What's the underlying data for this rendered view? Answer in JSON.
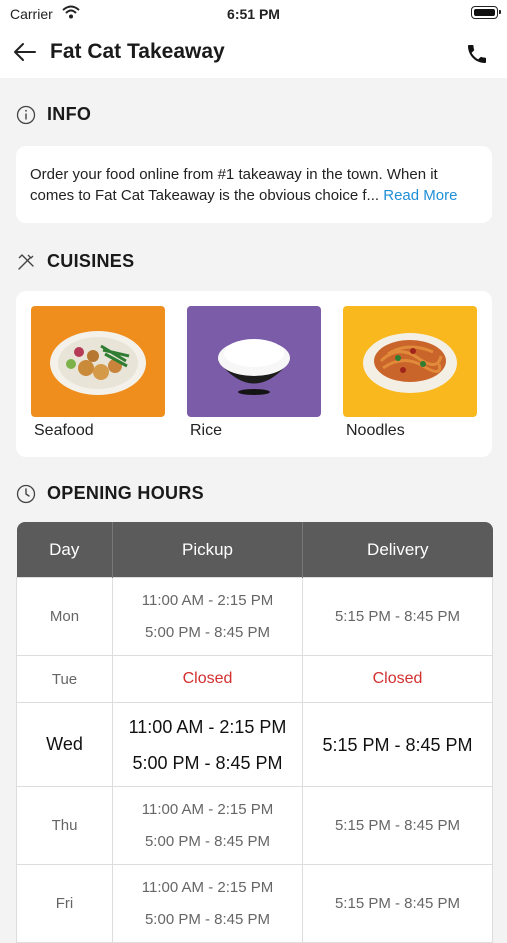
{
  "status_bar": {
    "carrier": "Carrier",
    "time": "6:51 PM"
  },
  "header": {
    "title": "Fat Cat Takeaway",
    "back_icon": "arrow-left-icon",
    "phone_icon": "phone-icon"
  },
  "info": {
    "title": "INFO",
    "text": "Order your food online from #1 takeaway in the town. When it comes to Fat Cat Takeaway is the obvious choice f...",
    "read_more": "Read More"
  },
  "cuisines": {
    "title": "CUISINES",
    "items": [
      {
        "label": "Seafood",
        "bg": "#ef8d1d"
      },
      {
        "label": "Rice",
        "bg": "#7b5ca8"
      },
      {
        "label": "Noodles",
        "bg": "#f8b81e"
      }
    ]
  },
  "opening_hours": {
    "title": "OPENING HOURS",
    "columns": [
      "Day",
      "Pickup",
      "Delivery"
    ],
    "rows": [
      {
        "day": "Mon",
        "pickup": [
          "11:00 AM - 2:15 PM",
          "5:00 PM - 8:45 PM"
        ],
        "delivery": [
          "5:15 PM - 8:45 PM"
        ]
      },
      {
        "day": "Tue",
        "pickup": [
          "Closed"
        ],
        "delivery": [
          "Closed"
        ]
      },
      {
        "day": "Wed",
        "pickup": [
          "11:00 AM - 2:15 PM",
          "5:00 PM - 8:45 PM"
        ],
        "delivery": [
          "5:15 PM - 8:45 PM"
        ],
        "today": true
      },
      {
        "day": "Thu",
        "pickup": [
          "11:00 AM - 2:15 PM",
          "5:00 PM - 8:45 PM"
        ],
        "delivery": [
          "5:15 PM - 8:45 PM"
        ]
      },
      {
        "day": "Fri",
        "pickup": [
          "11:00 AM - 2:15 PM",
          "5:00 PM - 8:45 PM"
        ],
        "delivery": [
          "5:15 PM - 8:45 PM"
        ]
      }
    ]
  }
}
